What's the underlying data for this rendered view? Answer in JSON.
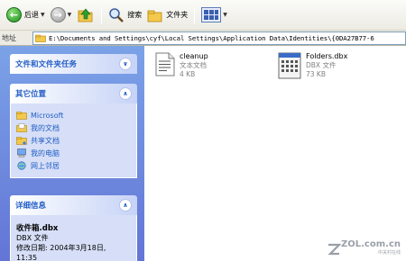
{
  "toolbar": {
    "back_label": "后退",
    "search_label": "搜索",
    "folders_label": "文件夹"
  },
  "address": {
    "label": "地址",
    "path": "E:\\Documents and Settings\\cyf\\Local Settings\\Application Data\\Identities\\{0DA27B77-6"
  },
  "sidebar": {
    "tasks_title": "文件和文件夹任务",
    "places_title": "其它位置",
    "places": [
      {
        "label": "Microsoft",
        "icon": "folder-icon"
      },
      {
        "label": "我的文档",
        "icon": "my-documents-icon"
      },
      {
        "label": "共享文档",
        "icon": "shared-documents-icon"
      },
      {
        "label": "我的电脑",
        "icon": "my-computer-icon"
      },
      {
        "label": "网上邻居",
        "icon": "network-places-icon"
      }
    ],
    "details_title": "详细信息",
    "details": {
      "name": "收件箱.dbx",
      "type": "DBX 文件",
      "modified_label": "修改日期: 2004年3月18日,",
      "time": "11:35"
    }
  },
  "files": [
    {
      "name": "cleanup",
      "type": "文本文档",
      "size": "4 KB",
      "icon": "text-document-icon"
    },
    {
      "name": "Folders.dbx",
      "type": "DBX 文件",
      "size": "73 KB",
      "icon": "dbx-file-icon"
    }
  ],
  "watermark": {
    "text": "ZOL.com.cn",
    "sub": "中关村在线"
  }
}
